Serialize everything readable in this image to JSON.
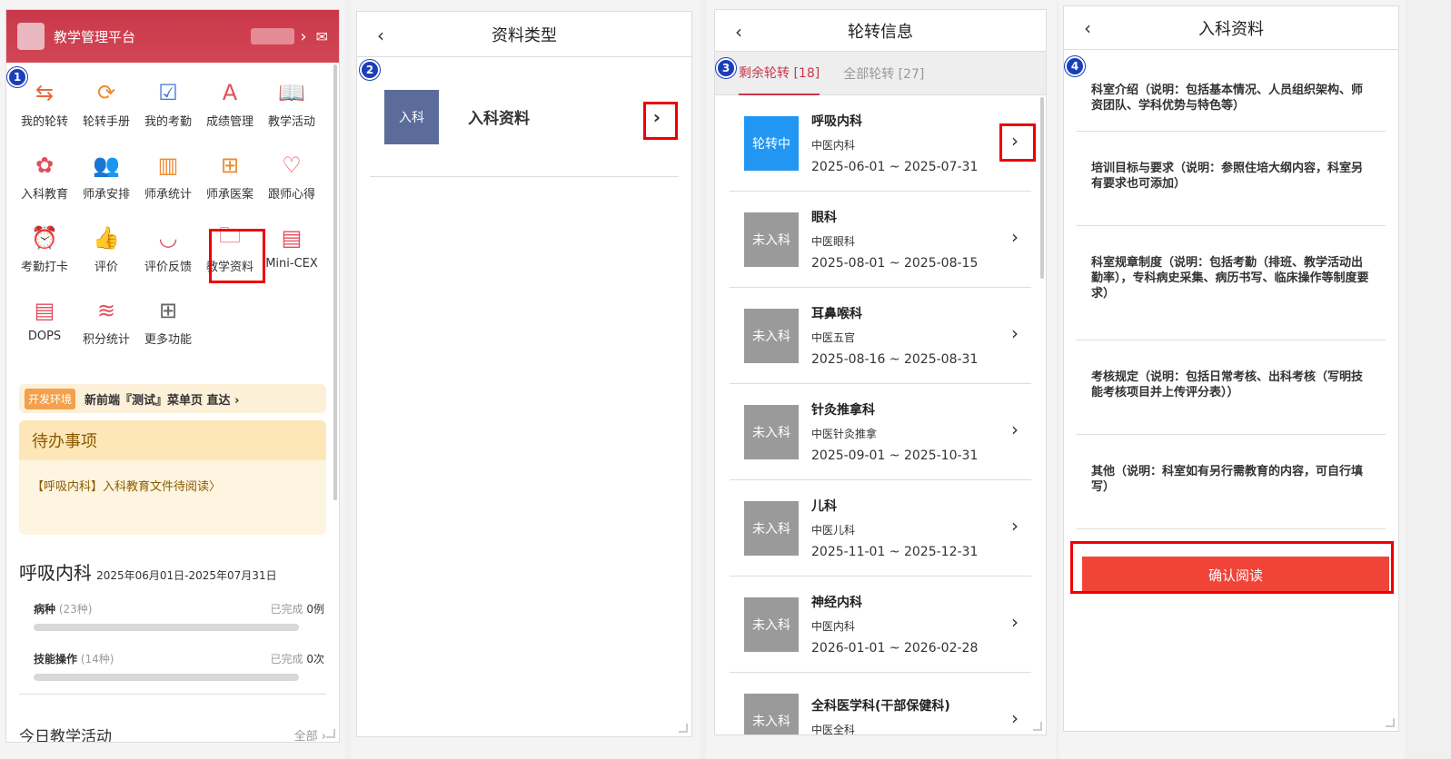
{
  "s1": {
    "app_title": "教学管理平台",
    "badge": "1",
    "grid": [
      {
        "label": "我的轮转",
        "icon": "⇆",
        "color": "#e36a3a"
      },
      {
        "label": "轮转手册",
        "icon": "⟳",
        "color": "#f08a2e"
      },
      {
        "label": "我的考勤",
        "icon": "☑",
        "color": "#3a78d8"
      },
      {
        "label": "成绩管理",
        "icon": "A",
        "color": "#e24d5b"
      },
      {
        "label": "教学活动",
        "icon": "📖",
        "color": "#e24d5b"
      },
      {
        "label": "入科教育",
        "icon": "✿",
        "color": "#e24d5b"
      },
      {
        "label": "师承安排",
        "icon": "👥",
        "color": "#e36a3a"
      },
      {
        "label": "师承统计",
        "icon": "▥",
        "color": "#f08a2e"
      },
      {
        "label": "师承医案",
        "icon": "⊞",
        "color": "#f08a2e"
      },
      {
        "label": "跟师心得",
        "icon": "♡",
        "color": "#e24d5b"
      },
      {
        "label": "考勤打卡",
        "icon": "⏰",
        "color": "#3a78d8"
      },
      {
        "label": "评价",
        "icon": "👍",
        "color": "#e24d5b"
      },
      {
        "label": "评价反馈",
        "icon": "◡",
        "color": "#e24d5b"
      },
      {
        "label": "教学资料",
        "icon": "🗀",
        "color": "#e24d5b"
      },
      {
        "label": "Mini-CEX",
        "icon": "▤",
        "color": "#e24d5b"
      },
      {
        "label": "DOPS",
        "icon": "▤",
        "color": "#e24d5b"
      },
      {
        "label": "积分统计",
        "icon": "≋",
        "color": "#e24d5b"
      },
      {
        "label": "更多功能",
        "icon": "⊞",
        "color": "#666"
      }
    ],
    "dev_tag": "开发环境",
    "dev_text": "新前端『测试』菜单页 直达 ›",
    "todo_title": "待办事项",
    "todo_item": "【呼吸内科】入科教育文件待阅读〉",
    "dept_name": "呼吸内科",
    "dept_dates": "2025年06月01日-2025年07月31日",
    "prog": [
      {
        "name": "病种",
        "count": "(23种)",
        "done": "已完成",
        "val": "0例"
      },
      {
        "name": "技能操作",
        "count": "(14种)",
        "done": "已完成",
        "val": "0次"
      }
    ],
    "today": "今日教学活动",
    "all": "全部 ›"
  },
  "s2": {
    "badge": "2",
    "title": "资料类型",
    "thumb": "入科",
    "name": "入科资料"
  },
  "s3": {
    "badge": "3",
    "title": "轮转信息",
    "tab1": "剩余轮转 [18]",
    "tab2": "全部轮转 [27]",
    "rows": [
      {
        "status": "轮转中",
        "on": true,
        "dept": "呼吸内科",
        "sub": "中医内科",
        "dates": "2025-06-01 ~ 2025-07-31"
      },
      {
        "status": "未入科",
        "on": false,
        "dept": "眼科",
        "sub": "中医眼科",
        "dates": "2025-08-01 ~ 2025-08-15"
      },
      {
        "status": "未入科",
        "on": false,
        "dept": "耳鼻喉科",
        "sub": "中医五官",
        "dates": "2025-08-16 ~ 2025-08-31"
      },
      {
        "status": "未入科",
        "on": false,
        "dept": "针灸推拿科",
        "sub": "中医针灸推拿",
        "dates": "2025-09-01 ~ 2025-10-31"
      },
      {
        "status": "未入科",
        "on": false,
        "dept": "儿科",
        "sub": "中医儿科",
        "dates": "2025-11-01 ~ 2025-12-31"
      },
      {
        "status": "未入科",
        "on": false,
        "dept": "神经内科",
        "sub": "中医内科",
        "dates": "2026-01-01 ~ 2026-02-28"
      },
      {
        "status": "未入科",
        "on": false,
        "dept": "全科医学科(干部保健科)",
        "sub": "中医全科",
        "dates": ""
      }
    ]
  },
  "s4": {
    "badge": "4",
    "title": "入科资料",
    "sections": [
      "科室介绍（说明：包括基本情况、人员组织架构、师资团队、学科优势与特色等）",
      "培训目标与要求（说明：参照住培大纲内容，科室另有要求也可添加）",
      "科室规章制度（说明：包括考勤（排班、教学活动出勤率），专科病史采集、病历书写、临床操作等制度要求）",
      "考核规定（说明：包括日常考核、出科考核（写明技能考核项目并上传评分表））",
      "其他（说明：科室如有另行需教育的内容，可自行填写）"
    ],
    "confirm": "确认阅读"
  }
}
